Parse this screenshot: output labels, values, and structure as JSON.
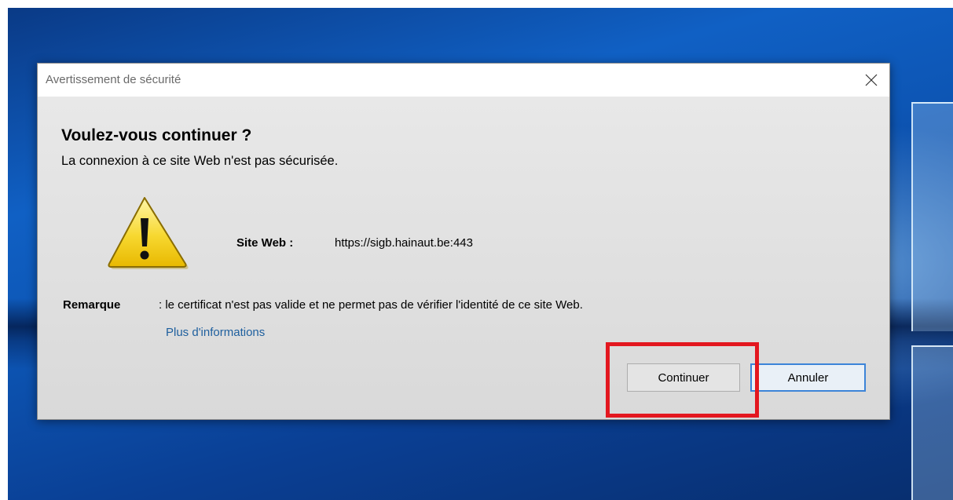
{
  "dialog": {
    "title": "Avertissement de sécurité",
    "close_icon": "close-icon",
    "heading": "Voulez-vous continuer ?",
    "subheading": "La connexion à ce site Web n'est pas sécurisée.",
    "warning_icon": "warning-triangle-icon",
    "site_label": "Site Web :",
    "site_value": "https://sigb.hainaut.be:443",
    "remark_label": "Remarque",
    "remark_text": ": le certificat n'est pas valide et ne permet pas de vérifier l'identité de ce site Web.",
    "more_info_link": "Plus d'informations",
    "continue_label": "Continuer",
    "cancel_label": "Annuler"
  },
  "colors": {
    "highlight": "#e3171f",
    "link": "#1e5f9e",
    "focus_border": "#3c84d8",
    "desktop_blue": "#1060c4"
  }
}
